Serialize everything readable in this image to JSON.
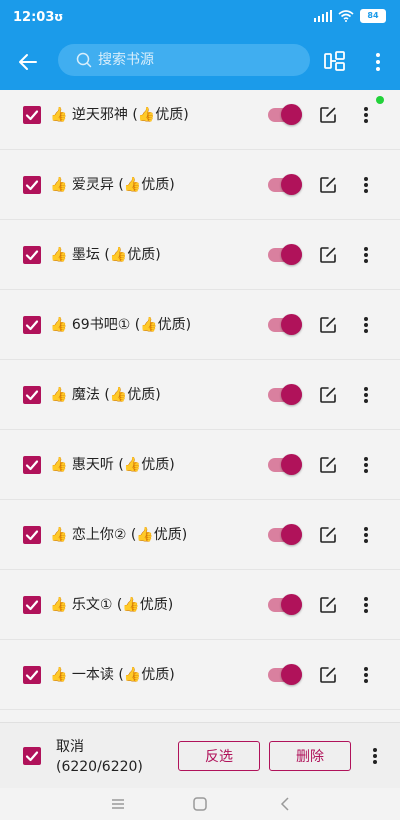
{
  "status_bar": {
    "time": "12:03",
    "carrier_icon": "ʊ",
    "battery": "84"
  },
  "app_bar": {
    "back_icon": "arrow-left-icon",
    "search_placeholder": "搜索书源",
    "group_icon": "group-layout-icon",
    "menu_icon": "more-vertical-icon"
  },
  "sources": [
    {
      "label": "👍 逆天邪神 (👍优质)",
      "checked": true,
      "enabled": true
    },
    {
      "label": "👍 爱灵异 (👍优质)",
      "checked": true,
      "enabled": true
    },
    {
      "label": "👍 墨坛 (👍优质)",
      "checked": true,
      "enabled": true
    },
    {
      "label": "👍 69书吧① (👍优质)",
      "checked": true,
      "enabled": true
    },
    {
      "label": "👍 魔法 (👍优质)",
      "checked": true,
      "enabled": true
    },
    {
      "label": "👍 惠天听 (👍优质)",
      "checked": true,
      "enabled": true
    },
    {
      "label": "👍 恋上你② (👍优质)",
      "checked": true,
      "enabled": true
    },
    {
      "label": "👍 乐文① (👍优质)",
      "checked": true,
      "enabled": true
    },
    {
      "label": "👍 一本读 (👍优质)",
      "checked": true,
      "enabled": true
    }
  ],
  "bottom_bar": {
    "select_label": "取消",
    "select_count": "(6220/6220)",
    "invert_label": "反选",
    "delete_label": "删除"
  },
  "colors": {
    "primary": "#1b9bea",
    "accent": "#b0125a",
    "toggle_track": "#d9809f",
    "indicator_dot": "#22d23a"
  }
}
